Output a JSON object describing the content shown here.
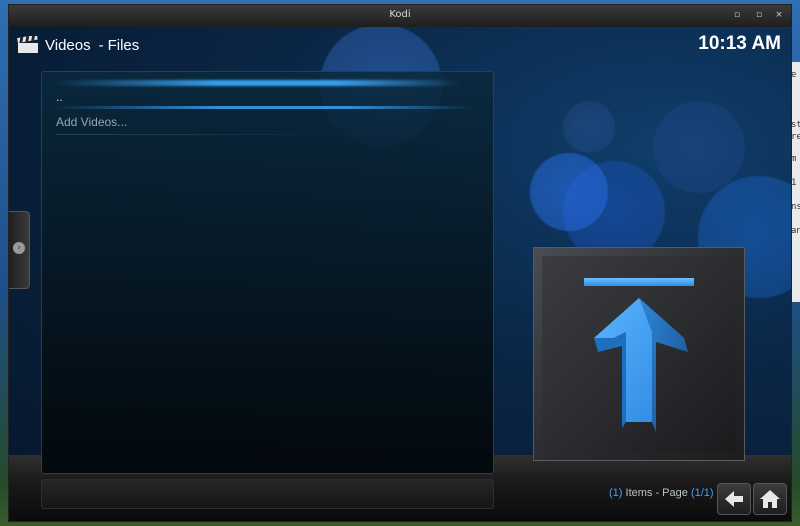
{
  "window": {
    "title": "Kodi",
    "controls": {
      "minimize": "▫",
      "maximize": "▫",
      "close": "×"
    }
  },
  "header": {
    "section": "Videos",
    "separator": "-",
    "subsection": "Files",
    "clock": "10:13 AM"
  },
  "list": {
    "items": [
      {
        "label": ".."
      },
      {
        "label": "Add Videos..."
      }
    ]
  },
  "footer": {
    "items_count": "(1)",
    "items_label": "Items - Page",
    "page": "(1/1)"
  },
  "desktop_strip": {
    "chars": [
      "e",
      "st",
      "re",
      "m",
      "1",
      "ns",
      "an"
    ]
  },
  "colors": {
    "accent": "#3fa2ff",
    "arrow": "#2e8ee6"
  },
  "icons": {
    "header": "clapperboard-icon",
    "thumbnail": "up-arrow-icon",
    "back": "back-arrow-icon",
    "home": "home-icon",
    "side_tab": "chevron-right-icon"
  }
}
